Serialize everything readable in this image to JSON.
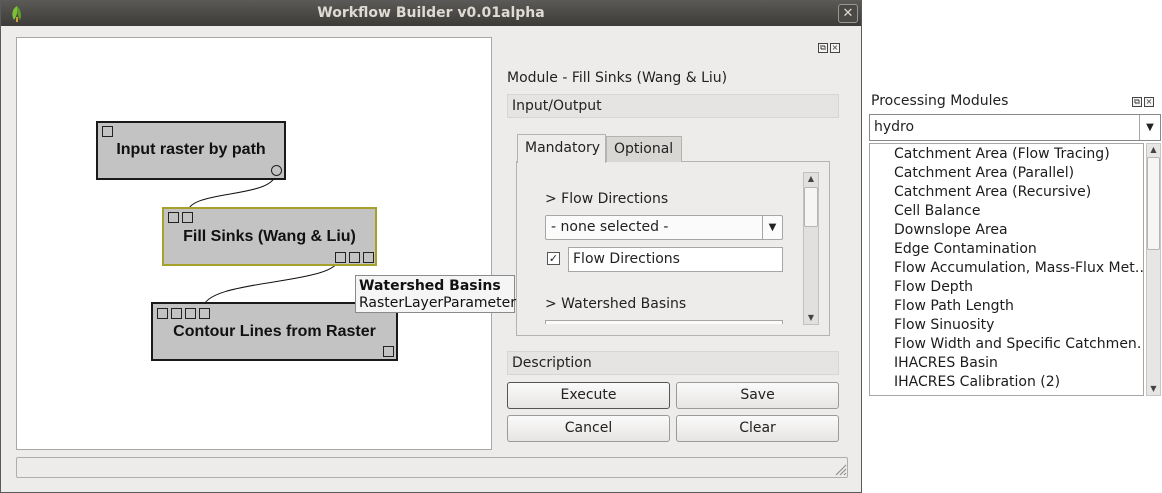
{
  "window": {
    "title": "Workflow Builder v0.01alpha",
    "close_glyph": "✕"
  },
  "canvas": {
    "nodes": [
      {
        "label": "Input raster by path"
      },
      {
        "label": "Fill Sinks (Wang & Liu)"
      },
      {
        "label": "Contour Lines from Raster"
      }
    ],
    "tooltip": {
      "title": "Watershed Basins",
      "subtitle": "RasterLayerParameter"
    }
  },
  "module_panel": {
    "title": "Module - Fill Sinks (Wang & Liu)",
    "io_section": "Input/Output",
    "tabs": [
      {
        "label": "Mandatory",
        "active": true
      },
      {
        "label": "Optional",
        "active": false
      }
    ],
    "flow_directions": {
      "section_label": "> Flow Directions",
      "select_value": "- none selected -",
      "checked": true,
      "name_value": "Flow Directions"
    },
    "watershed_basins": {
      "section_label": "> Watershed Basins"
    },
    "description_section": "Description",
    "buttons": {
      "execute": "Execute",
      "save": "Save",
      "cancel": "Cancel",
      "clear": "Clear"
    }
  },
  "processing_modules": {
    "title": "Processing Modules",
    "search_value": "hydro",
    "items": [
      "Catchment Area (Flow Tracing)",
      "Catchment Area (Parallel)",
      "Catchment Area (Recursive)",
      "Cell Balance",
      "Downslope Area",
      "Edge Contamination",
      "Flow Accumulation, Mass-Flux Met…",
      "Flow Depth",
      "Flow Path Length",
      "Flow Sinuosity",
      "Flow Width and Specific Catchmen…",
      "IHACRES Basin",
      "IHACRES Calibration (2)"
    ]
  },
  "colors": {
    "selected_node_border": "#a6a12b",
    "titlebar": "#3c3b37",
    "window_bg": "#edeceb"
  }
}
